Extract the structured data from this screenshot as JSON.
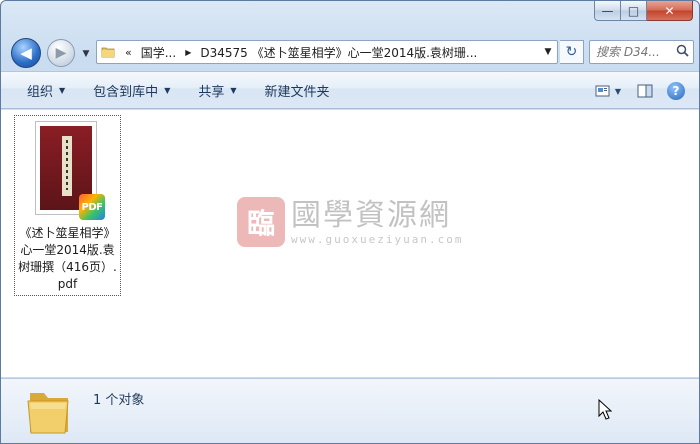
{
  "window": {
    "buttons": {
      "minimize": "—",
      "maximize": "□",
      "close": "✕"
    }
  },
  "nav": {
    "back_glyph": "◀",
    "forward_glyph": "▶",
    "dropdown_glyph": "▼"
  },
  "address": {
    "overflow_glyph": "«",
    "segments": [
      "国学...",
      "D34575 《述卜筮星相学》心一堂2014版.袁树珊..."
    ],
    "separator_glyph": "▶",
    "dropdown_glyph": "▼"
  },
  "refresh_glyph": "↻",
  "search": {
    "placeholder": "搜索 D34...",
    "icon_glyph": "🔍"
  },
  "toolbar": {
    "organize": "组织",
    "include_library": "包含到库中",
    "share": "共享",
    "new_folder": "新建文件夹",
    "arrow_glyph": "▼",
    "help_glyph": "?"
  },
  "files": [
    {
      "name": "《述卜筮星相学》心一堂2014版.袁树珊撰（416页）.pdf",
      "badge": "PDF"
    }
  ],
  "watermark": {
    "seal": "臨",
    "cn": "國學資源網",
    "url": "www.guoxueziyuan.com"
  },
  "status": {
    "text": "1 个对象"
  },
  "colors": {
    "accent": "#1e395b",
    "close": "#c1432b",
    "cover": "#8a1e25"
  }
}
